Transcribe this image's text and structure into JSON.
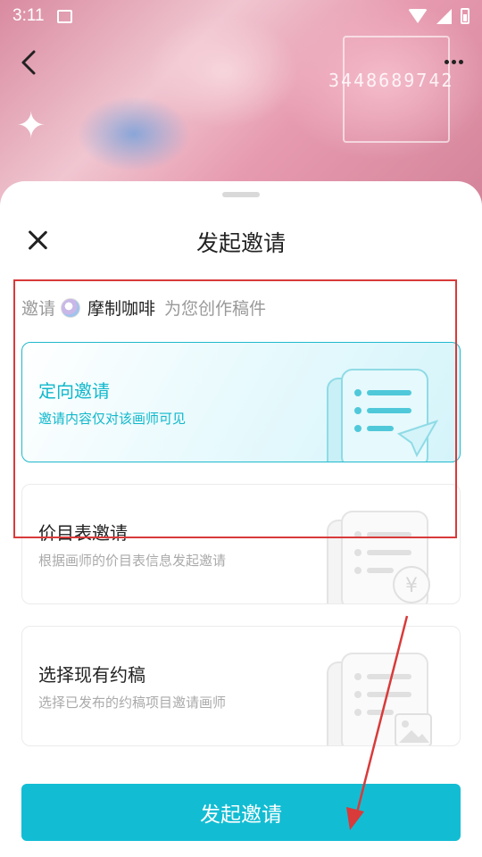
{
  "status_bar": {
    "time": "3:11"
  },
  "background_art": {
    "number_text": "3448689742"
  },
  "sheet": {
    "title": "发起邀请",
    "invite_line": {
      "prefix": "邀请",
      "artist_name": "摩制咖啡",
      "suffix": "为您创作稿件"
    },
    "options": [
      {
        "title": "定向邀请",
        "desc": "邀请内容仅对该画师可见",
        "selected": true,
        "icon": "document-send-icon"
      },
      {
        "title": "价目表邀请",
        "desc": "根据画师的价目表信息发起邀请",
        "selected": false,
        "icon": "document-price-icon"
      },
      {
        "title": "选择现有约稿",
        "desc": "选择已发布的约稿项目邀请画师",
        "selected": false,
        "icon": "document-image-icon"
      }
    ],
    "submit_label": "发起邀请"
  },
  "colors": {
    "accent": "#12bdd3",
    "annotation": "#d93a3a"
  }
}
